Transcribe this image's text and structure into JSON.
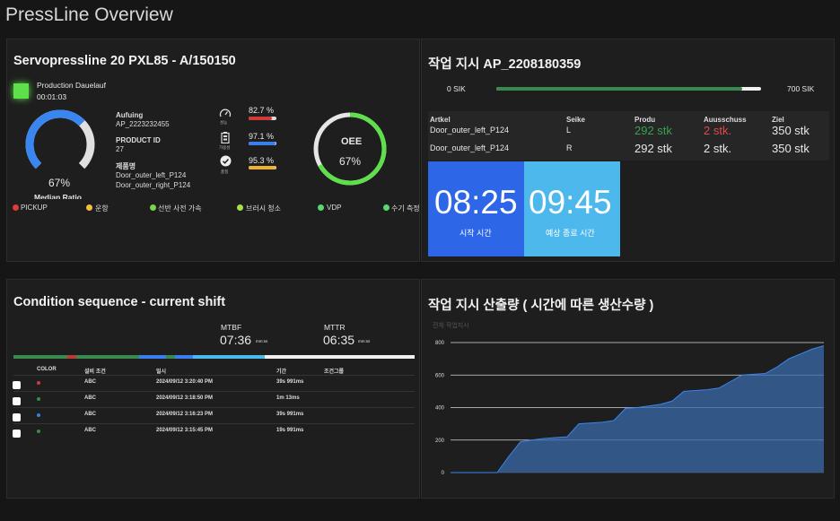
{
  "page": {
    "title": "PressLine Overview"
  },
  "machine": {
    "title": "Servopressline 20 PXL85 - A/150150",
    "status_label": "Production Dauelauf",
    "status_time": "00:01:03",
    "status_color": "#5ee04a",
    "gauge": {
      "value": "67%",
      "label": "Median Ratio",
      "fraction": 0.67
    },
    "aufuing_label": "Aufuing",
    "aufuing_value": "AP_2223232455",
    "product_id_label": "PRODUCT ID",
    "product_id_value": "27",
    "product_name_label": "제품명",
    "product_name_1": "Door_outer_left_P124",
    "product_name_2": "Door_outer_right_P124",
    "metrics": [
      {
        "icon": "speedometer-icon",
        "label": "성능",
        "value": "82.7 %",
        "fraction": 0.827,
        "color": "#d23a3a"
      },
      {
        "icon": "battery-icon",
        "label": "가용성",
        "value": "97.1 %",
        "fraction": 0.971,
        "color": "#3a7ef0"
      },
      {
        "icon": "check-circle-icon",
        "label": "품질",
        "value": "95.3 %",
        "fraction": 0.953,
        "color": "#f0b030"
      }
    ],
    "oee": {
      "label": "OEE",
      "value": "67%",
      "fraction": 0.67
    },
    "legend": [
      {
        "label": "PICKUP",
        "color": "#e03a3a"
      },
      {
        "label": "운항",
        "color": "#f0c040"
      },
      {
        "label": "선반 사전 가속",
        "color": "#7ad44a"
      },
      {
        "label": "브러시 청소",
        "color": "#a8e04a"
      },
      {
        "label": "VDP",
        "color": "#58d870"
      },
      {
        "label": "수기 측정",
        "color": "#58d870"
      }
    ]
  },
  "order": {
    "title": "작업 지시 AP_2208180359",
    "progress_start": "0 SIK",
    "progress_end": "700 SIK",
    "progress_fraction": 0.93,
    "headers": [
      "Artkel",
      "Seike",
      "Produ",
      "Auusschuss",
      "Ziel"
    ],
    "rows": [
      {
        "artkel": "Door_outer_left_P124",
        "seike": "L",
        "produ": "292 stk",
        "ausschuss": "2 stk.",
        "ziel": "350 stk",
        "highlight": true
      },
      {
        "artkel": "Door_outer_left_P124",
        "seike": "R",
        "produ": "292 stk",
        "ausschuss": "2 stk.",
        "ziel": "350 stk",
        "highlight": false
      }
    ],
    "start_time": "08:25",
    "start_label": "시작 시간",
    "end_time": "09:45",
    "end_label": "예상 종료 시간"
  },
  "condition": {
    "title": "Condition sequence - current shift",
    "mtbf_label": "MTBF",
    "mtbf_value": "07:36",
    "mtbf_unit": "mm:ss",
    "mttr_label": "MTTR",
    "mttr_value": "06:35",
    "mttr_unit": "mm:ss",
    "headers": [
      "COLOR",
      "설비 조건",
      "일시",
      "기간",
      "조건그룹"
    ],
    "rows": [
      {
        "color": "#d23a3a",
        "cond": "ABC",
        "time": "2024/09/12 3:20:40 PM",
        "dur": "39s 991ms"
      },
      {
        "color": "#3a8a50",
        "cond": "ABC",
        "time": "2024/09/12 3:18:50 PM",
        "dur": "1m 13ms"
      },
      {
        "color": "#3a7ef0",
        "cond": "ABC",
        "time": "2024/09/12 3:16:23 PM",
        "dur": "39s 991ms"
      },
      {
        "color": "#3a8a50",
        "cond": "ABC",
        "time": "2024/09/12 3:15:45 PM",
        "dur": "19s 991ms"
      }
    ]
  },
  "production_chart": {
    "title": "작업 지시 산출량 ( 시간에 따른 생산수량 )",
    "chart_data": {
      "type": "area",
      "series_label": "전체 작업지시",
      "yticks": [
        0,
        200,
        400,
        600,
        800
      ],
      "ylim": [
        0,
        800
      ],
      "x": [
        0,
        1,
        2,
        3,
        4,
        5,
        6,
        7,
        8,
        9,
        10,
        11,
        12,
        13,
        14,
        15,
        16,
        17,
        18,
        19,
        20,
        21,
        22,
        23,
        24,
        25,
        26,
        27,
        28,
        29,
        30,
        31,
        32
      ],
      "values": [
        0,
        0,
        0,
        0,
        0,
        100,
        190,
        200,
        210,
        215,
        220,
        300,
        305,
        310,
        320,
        395,
        400,
        410,
        420,
        440,
        500,
        505,
        510,
        520,
        560,
        600,
        605,
        610,
        650,
        700,
        730,
        760,
        780
      ],
      "color": "#3a6aa8"
    }
  }
}
